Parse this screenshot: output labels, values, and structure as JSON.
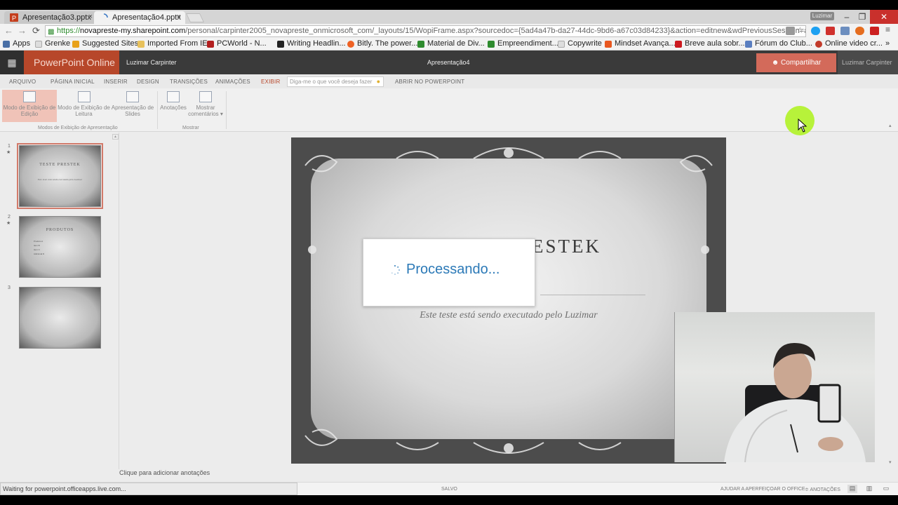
{
  "browser": {
    "tabs": [
      {
        "title": "Apresentação3.pptx",
        "close": "×",
        "active": false
      },
      {
        "title": "Apresentação4.pptx",
        "close": "×",
        "active": true
      }
    ],
    "profile_name": "Luzimar",
    "window": {
      "minimize": "–",
      "maximize": "❐",
      "close": "✕"
    },
    "url": {
      "scheme": "https://",
      "host": "novapreste-my.sharepoint.com",
      "path": "/personal/carpinter2005_novapreste_onmicrosoft_com/_layouts/15/WopiFrame.aspx?sourcedoc={5ad4a47b-da27-44dc-9bd6-a67c03d84233}&action=editnew&wdPreviousSession=a"
    },
    "nav": {
      "back": "←",
      "forward": "→",
      "reload": "⟳"
    },
    "bookmarks": [
      "Apps",
      "Grenke",
      "Suggested Sites",
      "Imported From IE",
      "PCWorld - N...",
      "Writing Headlin...",
      "Bitly. The power...",
      "Material de Div...",
      "Empreendiment...",
      "Copywrite",
      "Mindset Avança...",
      "Breve aula sobr...",
      "Fórum do Club...",
      "Online video cr..."
    ],
    "bookmark_more": "»"
  },
  "app": {
    "name": "PowerPoint Online",
    "user": "Luzimar Carpinter",
    "document_title": "Apresentação4",
    "share_label": "Compartilhar",
    "header_user": "Luzimar Carpinter"
  },
  "ribbon": {
    "tabs": [
      "ARQUIVO",
      "PÁGINA INICIAL",
      "INSERIR",
      "DESIGN",
      "TRANSIÇÕES",
      "ANIMAÇÕES",
      "EXIBIR"
    ],
    "active_tab": "EXIBIR",
    "tell_me_placeholder": "Diga-me o que você deseja fazer",
    "open_in_app": "ABRIR NO POWERPOINT",
    "buttons": [
      {
        "label": "Modo de Exibição de Edição",
        "line1": "Modo de Exibição de",
        "line2": "Edição",
        "selected": true
      },
      {
        "label": "Modo de Exibição de Leitura",
        "line1": "Modo de Exibição de",
        "line2": "Leitura",
        "selected": false
      },
      {
        "label": "Apresentação de Slides",
        "line1": "Apresentação de",
        "line2": "Slides",
        "selected": false
      },
      {
        "label": "Anotações",
        "line1": "Anotações",
        "line2": "",
        "selected": false
      },
      {
        "label": "Mostrar comentários",
        "line1": "Mostrar",
        "line2": "comentários ▾",
        "selected": false
      }
    ],
    "groups": [
      "Modos de Exibição de Apresentação",
      "Mostrar"
    ]
  },
  "thumbnails": [
    {
      "number": "1",
      "title": "TESTE PRESTEK",
      "subtitle": "Este teste está sendo executado pelo Luzimar",
      "selected": true
    },
    {
      "number": "2",
      "title": "PRODUTOS",
      "list": [
        "Produto A",
        "Item B",
        "Item C",
        "Adicional D"
      ],
      "selected": false
    },
    {
      "number": "3",
      "title": "",
      "selected": false
    }
  ],
  "slide": {
    "title_visible": "ESTEK",
    "subtitle": "Este teste está sendo executado pelo Luzimar"
  },
  "processing_dialog": {
    "text": "Processando..."
  },
  "notes_placeholder": "Clique para adicionar anotações",
  "status": {
    "loading": "Waiting for powerpoint.officeapps.live.com...",
    "saved": "SALVO",
    "help": "AJUDAR A APERFEIÇOAR O OFFICE",
    "notes": "ANOTAÇÕES"
  },
  "colors": {
    "accent": "#b7472a",
    "share": "#d36a5a",
    "processing_text": "#2b79b7",
    "cursor_highlight": "#b7f23a"
  }
}
